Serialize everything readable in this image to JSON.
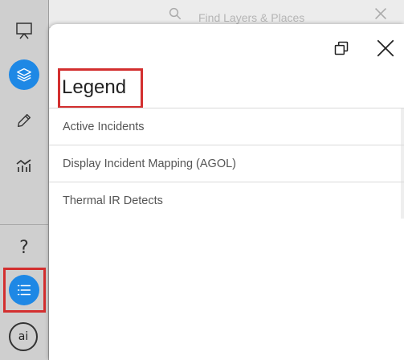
{
  "search": {
    "placeholder": "Find Layers & Places"
  },
  "panel": {
    "title": "Legend",
    "items": [
      {
        "label": "Active Incidents"
      },
      {
        "label": "Display Incident Mapping (AGOL)"
      },
      {
        "label": "Thermal IR Detects"
      }
    ]
  },
  "toolbar": {
    "buttons": [
      {
        "icon": "presentation-icon",
        "active": false
      },
      {
        "icon": "layers-icon",
        "active": true
      },
      {
        "icon": "pencil-icon",
        "active": false
      },
      {
        "icon": "analytics-icon",
        "active": false
      },
      {
        "icon": "help-icon",
        "label": "?",
        "active": false
      },
      {
        "icon": "legend-list-icon",
        "active": true
      },
      {
        "icon": "ai-icon",
        "label": "ai",
        "active": false
      }
    ]
  },
  "colors": {
    "accent": "#1e88e5",
    "highlight": "#d32f2f",
    "toolbar": "#cfcfcf"
  }
}
